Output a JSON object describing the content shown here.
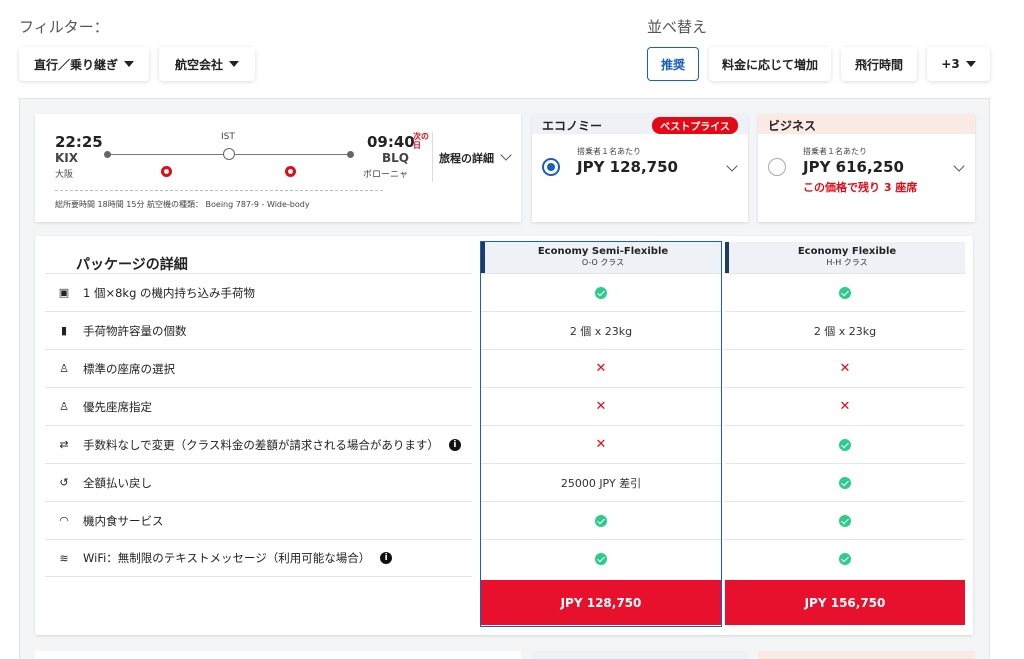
{
  "filters": {
    "title": "フィルター：",
    "chips": [
      "直行／乗り継ぎ",
      "航空会社"
    ]
  },
  "sort": {
    "title": "並べ替え",
    "options": [
      "推奨",
      "料金に応じて増加",
      "飛行時間",
      "+3"
    ],
    "selected": "推奨"
  },
  "flight": {
    "dep_time": "22:25",
    "dep_code": "KIX",
    "dep_city": "大阪",
    "stop_code": "IST",
    "arr_time": "09:40",
    "next_day": "次の\n日",
    "arr_code": "BLQ",
    "arr_city": "ボローニャ",
    "details_label": "旅程の詳細",
    "footer": "総所要時間 18時間 15分  航空機の種類： Boeing 787-9 - Wide-body"
  },
  "fares": [
    {
      "cabin": "エコノミー",
      "badge": "ベストプライス",
      "per_pax": "搭乗者１名あたり",
      "price": "JPY 128,750",
      "selected": true
    },
    {
      "cabin": "ビジネス",
      "per_pax": "搭乗者１名あたり",
      "price": "JPY 616,250",
      "note": "この価格で残り 3 座席",
      "selected": false
    }
  ],
  "package": {
    "title": "パッケージの詳細",
    "features": [
      {
        "icon": "carry-on-bag-icon",
        "label": "1 個×8kg の機内持ち込み手荷物"
      },
      {
        "icon": "checked-bag-icon",
        "label": "手荷物許容量の個数"
      },
      {
        "icon": "seat-icon",
        "label": "標準の座席の選択"
      },
      {
        "icon": "seat-icon",
        "label": "優先座席指定"
      },
      {
        "icon": "change-icon",
        "label": "手数料なしで変更（クラス料金の差額が請求される場合があります）",
        "info": true
      },
      {
        "icon": "refund-icon",
        "label": "全額払い戻し"
      },
      {
        "icon": "meal-icon",
        "label": "機内食サービス"
      },
      {
        "icon": "wifi-icon",
        "label": "WiFi：無制限のテキストメッセージ（利用可能な場合）",
        "info": true
      }
    ],
    "columns": [
      {
        "name": "Economy Semi-Flexible",
        "class_code": "O-O クラス",
        "values": [
          "check",
          "2 個 x 23kg",
          "x",
          "x",
          "x",
          "25000 JPY 差引",
          "check",
          "check"
        ],
        "price": "JPY 128,750",
        "selected": true
      },
      {
        "name": "Economy Flexible",
        "class_code": "H-H クラス",
        "values": [
          "check",
          "2 個 x 23kg",
          "x",
          "x",
          "check",
          "check",
          "check",
          "check"
        ],
        "price": "JPY 156,750",
        "selected": false
      }
    ]
  },
  "colors": {
    "accent": "#1a5fbf",
    "brand_red": "#e30a17",
    "check_green": "#2ecc8a"
  }
}
